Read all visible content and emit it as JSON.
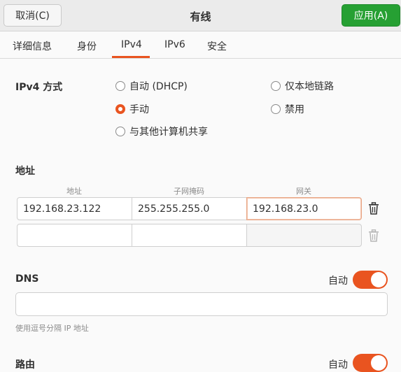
{
  "header": {
    "cancel_label": "取消(C)",
    "title": "有线",
    "apply_label": "应用(A)",
    "apply_color": "#26a033"
  },
  "tabs": [
    {
      "label": "详细信息"
    },
    {
      "label": "身份"
    },
    {
      "label": "IPv4",
      "active": true
    },
    {
      "label": "IPv6"
    },
    {
      "label": "安全"
    }
  ],
  "ipv4_method": {
    "label": "IPv4 方式",
    "options": [
      {
        "label": "自动 (DHCP)",
        "selected": false
      },
      {
        "label": "仅本地链路",
        "selected": false
      },
      {
        "label": "手动",
        "selected": true
      },
      {
        "label": "禁用",
        "selected": false
      },
      {
        "label": "与其他计算机共享",
        "selected": false
      }
    ]
  },
  "addresses": {
    "label": "地址",
    "columns": [
      "地址",
      "子网掩码",
      "网关"
    ],
    "rows": [
      {
        "address": "192.168.23.122",
        "netmask": "255.255.255.0",
        "gateway": "192.168.23.0"
      },
      {
        "address": "",
        "netmask": "",
        "gateway": ""
      }
    ]
  },
  "dns": {
    "label": "DNS",
    "auto_label": "自动",
    "auto_on": true,
    "value": "",
    "hint": "使用逗号分隔 IP 地址"
  },
  "routes": {
    "label": "路由",
    "auto_label": "自动",
    "auto_on": true
  },
  "accent_color": "#e95420",
  "icons": {
    "trash": "trash-icon"
  }
}
